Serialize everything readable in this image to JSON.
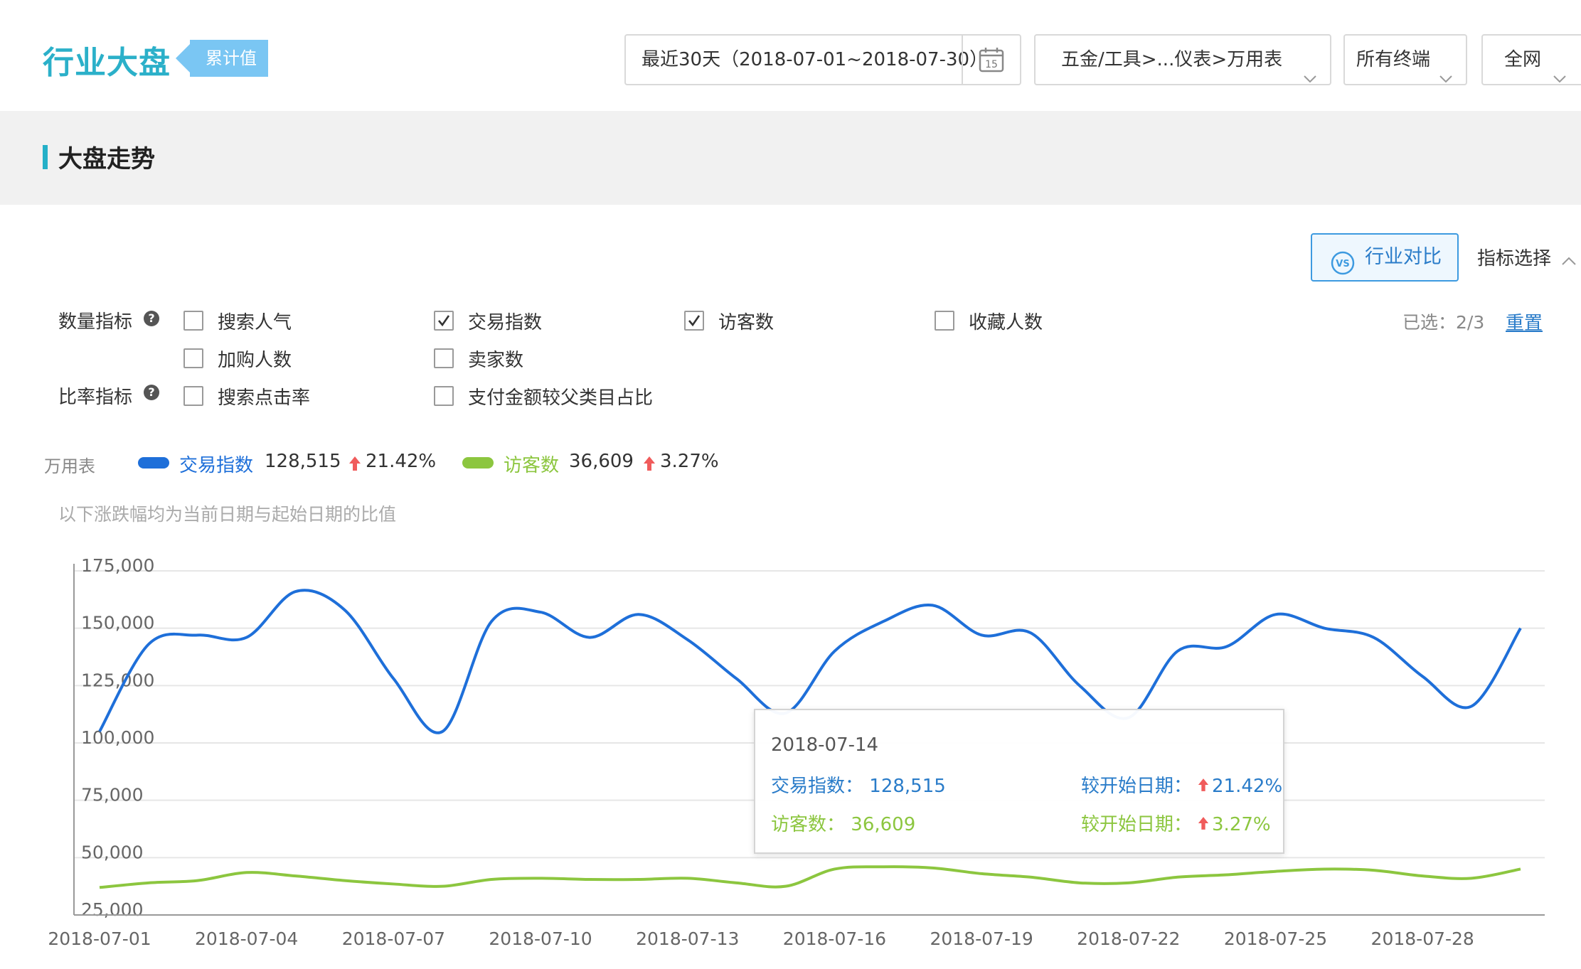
{
  "header": {
    "title": "行业大盘",
    "badge": "累计值",
    "date_range": "最近30天（2018-07-01~2018-07-30）",
    "calendar_day": "15",
    "category": "五金/工具>...仪表>万用表",
    "terminal": "所有终端",
    "network": "全网"
  },
  "section": {
    "title": "大盘走势"
  },
  "toolbar": {
    "compare_label": "行业对比",
    "metric_select_label": "指标选择"
  },
  "metrics": {
    "quantity_label": "数量指标",
    "rate_label": "比率指标",
    "help_glyph": "?",
    "options": [
      {
        "label": "搜索人气",
        "checked": false
      },
      {
        "label": "交易指数",
        "checked": true
      },
      {
        "label": "访客数",
        "checked": true
      },
      {
        "label": "收藏人数",
        "checked": false
      },
      {
        "label": "加购人数",
        "checked": false
      },
      {
        "label": "卖家数",
        "checked": false
      },
      {
        "label": "搜索点击率",
        "checked": false
      },
      {
        "label": "支付金额较父类目占比",
        "checked": false
      }
    ],
    "selected_text": "已选：2/3",
    "reset_label": "重置"
  },
  "legend": {
    "category": "万用表",
    "items": [
      {
        "name": "交易指数",
        "value": "128,515",
        "change": "21.42%",
        "color": "#1e6fd9"
      },
      {
        "name": "访客数",
        "value": "36,609",
        "change": "3.27%",
        "color": "#8cc63f"
      }
    ],
    "note": "以下涨跌幅均为当前日期与起始日期的比值"
  },
  "tooltip": {
    "date": "2018-07-14",
    "series1_label": "交易指数：",
    "series1_value": "128,515",
    "series2_label": "访客数：",
    "series2_value": "36,609",
    "compare_label": "较开始日期：",
    "series1_change": "21.42%",
    "series2_change": "3.27%"
  },
  "colors": {
    "accent": "#25b0c8",
    "link": "#2a7cc9",
    "up_arrow": "#f05b5b"
  },
  "chart_data": {
    "type": "line",
    "x": [
      "2018-07-01",
      "2018-07-02",
      "2018-07-03",
      "2018-07-04",
      "2018-07-05",
      "2018-07-06",
      "2018-07-07",
      "2018-07-08",
      "2018-07-09",
      "2018-07-10",
      "2018-07-11",
      "2018-07-12",
      "2018-07-13",
      "2018-07-14",
      "2018-07-15",
      "2018-07-16",
      "2018-07-17",
      "2018-07-18",
      "2018-07-19",
      "2018-07-20",
      "2018-07-21",
      "2018-07-22",
      "2018-07-23",
      "2018-07-24",
      "2018-07-25",
      "2018-07-26",
      "2018-07-27",
      "2018-07-28",
      "2018-07-29",
      "2018-07-30"
    ],
    "xticks": [
      "2018-07-01",
      "2018-07-04",
      "2018-07-07",
      "2018-07-10",
      "2018-07-13",
      "2018-07-16",
      "2018-07-19",
      "2018-07-22",
      "2018-07-25",
      "2018-07-28"
    ],
    "yticks": [
      "175,000",
      "150,000",
      "125,000",
      "100,000",
      "75,000",
      "50,000",
      "25,000"
    ],
    "ylim": [
      25000,
      175000
    ],
    "grid": true,
    "series": [
      {
        "name": "交易指数",
        "color": "#1e6fd9",
        "values": [
          105000,
          143000,
          147000,
          146000,
          166000,
          158000,
          128000,
          105000,
          153000,
          157000,
          146000,
          156000,
          145000,
          128000,
          113000,
          140000,
          153000,
          160000,
          147000,
          148000,
          125000,
          111000,
          140000,
          142000,
          156000,
          150000,
          146000,
          129000,
          116000,
          150000
        ]
      },
      {
        "name": "访客数",
        "color": "#8cc63f",
        "values": [
          37000,
          39000,
          40000,
          43500,
          42000,
          40000,
          38500,
          37500,
          40500,
          41000,
          40500,
          40500,
          41000,
          39000,
          37500,
          45000,
          46000,
          45500,
          43000,
          41500,
          39000,
          39000,
          41500,
          42500,
          44000,
          45000,
          44500,
          42000,
          41000,
          45000
        ]
      }
    ]
  }
}
